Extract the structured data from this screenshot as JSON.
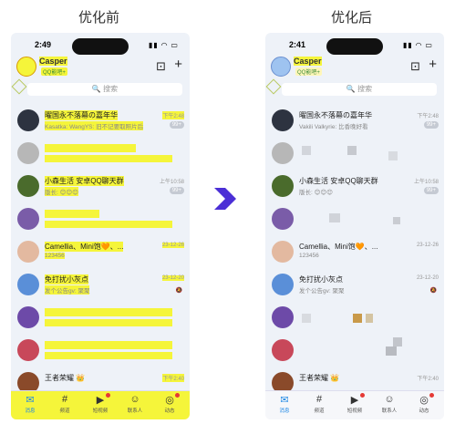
{
  "captions": {
    "before": "优化前",
    "after": "优化后"
  },
  "status": {
    "time_left": "2:49",
    "time_right": "2:41",
    "signal": "▮▮ ◠ ▭"
  },
  "user": {
    "name": "Casper",
    "status_left": "QQ能吧+",
    "status_right": "QQ能吧+"
  },
  "search": {
    "placeholder": "搜索"
  },
  "conversations": [
    {
      "name": "曜国永不落幕の嘉年华",
      "message": "Vakili Valkyrie: 比香晚好看",
      "message_left": "Kasatka: WangYS: 旧不记要取照片后",
      "time": "下午2:48",
      "badge": "99+",
      "avatar_color": "#2d3340"
    },
    {
      "name": "",
      "message": "",
      "time": "",
      "badge": "",
      "avatar_color": "#b7b7b7"
    },
    {
      "name": "小森生活 安卓QQ聊天群",
      "message": "版长: 😊😊😊",
      "message_left": "版长: 😊😊😊",
      "time": "上午10:58",
      "badge": "99+",
      "avatar_color": "#4a6b2c"
    },
    {
      "name": "",
      "message": "",
      "time": "",
      "badge": "",
      "avatar_color": "#7a5ca8"
    },
    {
      "name": "Camellia、Mini饱🧡、...",
      "message": "123456",
      "time": "23-12-26",
      "badge": "",
      "avatar_color": "#e3b9a0"
    },
    {
      "name": "免打扰小灰点",
      "message": "发个公告gv: 聚聚",
      "time": "23-12-20",
      "badge": "",
      "avatar_color": "#5a8fd8"
    },
    {
      "name": "",
      "message": "",
      "time": "",
      "badge": "",
      "avatar_color": "#6d4aa8"
    },
    {
      "name": "",
      "message": "",
      "time": "",
      "badge": "",
      "avatar_color": "#c8485a"
    },
    {
      "name": "王者荣耀 👑",
      "message": "",
      "time": "下午2:40",
      "badge": "",
      "avatar_color": "#8a4a2a"
    }
  ],
  "tabs": [
    {
      "label": "消息",
      "icon": "message-icon",
      "glyph": "✉"
    },
    {
      "label": "频道",
      "icon": "channel-icon",
      "glyph": "#"
    },
    {
      "label": "短视频",
      "icon": "video-icon",
      "glyph": "▶"
    },
    {
      "label": "联系人",
      "icon": "contacts-icon",
      "glyph": "☺"
    },
    {
      "label": "动态",
      "icon": "feed-icon",
      "glyph": "◎"
    }
  ],
  "colors": {
    "highlight": "#f5f53a",
    "accent": "#1e88e5",
    "arrow": "#4b2fd6",
    "phone_bg": "#eef2f8"
  }
}
